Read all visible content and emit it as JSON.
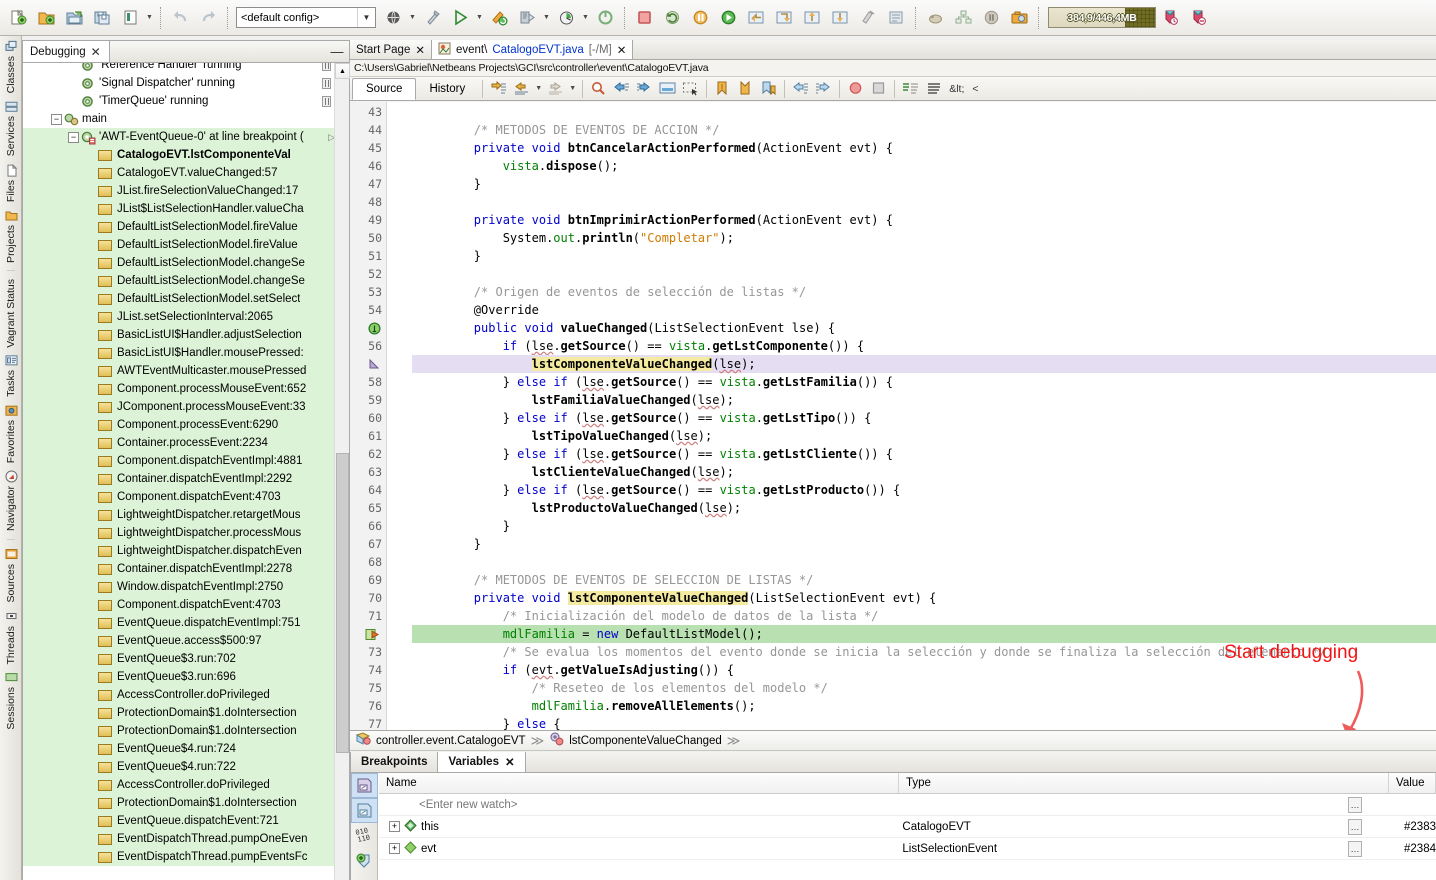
{
  "toolbar": {
    "config_value": "<default config>",
    "memory": "384,9/446,4MB",
    "buttons": [
      {
        "name": "new-file-button",
        "label": "New File"
      },
      {
        "name": "new-project-button",
        "label": "New Project"
      },
      {
        "name": "open-project-button",
        "label": "Open Project"
      },
      {
        "name": "save-all-button",
        "label": "Save All"
      },
      {
        "name": "open-recent-button",
        "label": "Open Recent"
      },
      {
        "name": "undo-button",
        "label": "Undo"
      },
      {
        "name": "redo-button",
        "label": "Redo"
      },
      {
        "name": "build-project-button",
        "label": "Build Project"
      },
      {
        "name": "clean-build-button",
        "label": "Clean and Build"
      },
      {
        "name": "run-project-button",
        "label": "Run Project"
      },
      {
        "name": "debug-project-button",
        "label": "Debug Project"
      },
      {
        "name": "profile-project-button",
        "label": "Profile Project"
      },
      {
        "name": "team-button",
        "label": "Team"
      },
      {
        "name": "stop-button",
        "label": "Finish Debugger Session"
      },
      {
        "name": "continue-button",
        "label": "Continue"
      },
      {
        "name": "pause-button",
        "label": "Pause"
      },
      {
        "name": "step-over-button",
        "label": "Step Over"
      },
      {
        "name": "step-into-button",
        "label": "Step Into"
      },
      {
        "name": "step-out-button",
        "label": "Step Out"
      },
      {
        "name": "run-to-cursor-button",
        "label": "Run to Cursor"
      },
      {
        "name": "apply-code-changes-button",
        "label": "Apply Code Changes"
      },
      {
        "name": "take-gc-button",
        "label": "Garbage Collect"
      },
      {
        "name": "heap-walker-button",
        "label": "Heap Walker"
      },
      {
        "name": "screenshot-button",
        "label": "Take Screenshot"
      },
      {
        "name": "new-watch-button",
        "label": "New Watch"
      },
      {
        "name": "toggle-breakpoint-button",
        "label": "Toggle Breakpoint"
      }
    ]
  },
  "left_rail": {
    "tabs": [
      {
        "label": "Classes",
        "icon": "classes-icon"
      },
      {
        "label": "Services",
        "icon": "services-icon"
      },
      {
        "label": "Files",
        "icon": "files-icon"
      },
      {
        "label": "Projects",
        "icon": "projects-icon"
      },
      {
        "label": "Vagrant Status",
        "icon": "vagrant-icon"
      },
      {
        "label": "Tasks",
        "icon": "tasks-icon"
      },
      {
        "label": "Favorites",
        "icon": "favorites-icon"
      },
      {
        "label": "Navigator",
        "icon": "navigator-icon"
      },
      {
        "label": "Sources",
        "icon": "sources-icon"
      },
      {
        "label": "Threads",
        "icon": "threads-icon"
      },
      {
        "label": "Sessions",
        "icon": "sessions-icon"
      }
    ]
  },
  "debugging_panel": {
    "tab_label": "Debugging",
    "close_label": "✕",
    "minimize_label": "—",
    "rows": [
      {
        "label": "'Reference Handler' running",
        "type": "thread",
        "clipped": true,
        "green": false,
        "depth": 2
      },
      {
        "label": "'Signal Dispatcher' running",
        "type": "thread",
        "green": false,
        "depth": 2
      },
      {
        "label": "'TimerQueue' running",
        "type": "thread",
        "green": false,
        "depth": 2
      },
      {
        "label": "main",
        "type": "group",
        "green": false,
        "depth": 1
      },
      {
        "label": "'AWT-EventQueue-0' at line breakpoint (",
        "type": "current-thread",
        "green": true,
        "depth": 2
      },
      {
        "label": "CatalogoEVT.lstComponenteVal",
        "type": "frame",
        "green": true,
        "bold": true,
        "depth": 3
      },
      {
        "label": "CatalogoEVT.valueChanged:57",
        "type": "frame",
        "green": true,
        "depth": 3
      },
      {
        "label": "JList.fireSelectionValueChanged:17",
        "type": "frame",
        "green": true,
        "depth": 3
      },
      {
        "label": "JList$ListSelectionHandler.valueCha",
        "type": "frame",
        "green": true,
        "depth": 3
      },
      {
        "label": "DefaultListSelectionModel.fireValue",
        "type": "frame",
        "green": true,
        "depth": 3
      },
      {
        "label": "DefaultListSelectionModel.fireValue",
        "type": "frame",
        "green": true,
        "depth": 3
      },
      {
        "label": "DefaultListSelectionModel.changeSe",
        "type": "frame",
        "green": true,
        "depth": 3
      },
      {
        "label": "DefaultListSelectionModel.changeSe",
        "type": "frame",
        "green": true,
        "depth": 3
      },
      {
        "label": "DefaultListSelectionModel.setSelect",
        "type": "frame",
        "green": true,
        "depth": 3
      },
      {
        "label": "JList.setSelectionInterval:2065",
        "type": "frame",
        "green": true,
        "depth": 3
      },
      {
        "label": "BasicListUI$Handler.adjustSelection",
        "type": "frame",
        "green": true,
        "depth": 3
      },
      {
        "label": "BasicListUI$Handler.mousePressed:",
        "type": "frame",
        "green": true,
        "depth": 3
      },
      {
        "label": "AWTEventMulticaster.mousePressed",
        "type": "frame",
        "green": true,
        "depth": 3
      },
      {
        "label": "Component.processMouseEvent:652",
        "type": "frame",
        "green": true,
        "depth": 3
      },
      {
        "label": "JComponent.processMouseEvent:33",
        "type": "frame",
        "green": true,
        "depth": 3
      },
      {
        "label": "Component.processEvent:6290",
        "type": "frame",
        "green": true,
        "depth": 3
      },
      {
        "label": "Container.processEvent:2234",
        "type": "frame",
        "green": true,
        "depth": 3
      },
      {
        "label": "Component.dispatchEventImpl:4881",
        "type": "frame",
        "green": true,
        "depth": 3
      },
      {
        "label": "Container.dispatchEventImpl:2292",
        "type": "frame",
        "green": true,
        "depth": 3
      },
      {
        "label": "Component.dispatchEvent:4703",
        "type": "frame",
        "green": true,
        "depth": 3
      },
      {
        "label": "LightweightDispatcher.retargetMous",
        "type": "frame",
        "green": true,
        "depth": 3
      },
      {
        "label": "LightweightDispatcher.processMous",
        "type": "frame",
        "green": true,
        "depth": 3
      },
      {
        "label": "LightweightDispatcher.dispatchEven",
        "type": "frame",
        "green": true,
        "depth": 3
      },
      {
        "label": "Container.dispatchEventImpl:2278",
        "type": "frame",
        "green": true,
        "depth": 3
      },
      {
        "label": "Window.dispatchEventImpl:2750",
        "type": "frame",
        "green": true,
        "depth": 3
      },
      {
        "label": "Component.dispatchEvent:4703",
        "type": "frame",
        "green": true,
        "depth": 3
      },
      {
        "label": "EventQueue.dispatchEventImpl:751",
        "type": "frame",
        "green": true,
        "depth": 3
      },
      {
        "label": "EventQueue.access$500:97",
        "type": "frame",
        "green": true,
        "depth": 3
      },
      {
        "label": "EventQueue$3.run:702",
        "type": "frame",
        "green": true,
        "depth": 3
      },
      {
        "label": "EventQueue$3.run:696",
        "type": "frame",
        "green": true,
        "depth": 3
      },
      {
        "label": "AccessController.doPrivileged",
        "type": "frame",
        "green": true,
        "depth": 3
      },
      {
        "label": "ProtectionDomain$1.doIntersection",
        "type": "frame",
        "green": true,
        "depth": 3
      },
      {
        "label": "ProtectionDomain$1.doIntersection",
        "type": "frame",
        "green": true,
        "depth": 3
      },
      {
        "label": "EventQueue$4.run:724",
        "type": "frame",
        "green": true,
        "depth": 3
      },
      {
        "label": "EventQueue$4.run:722",
        "type": "frame",
        "green": true,
        "depth": 3
      },
      {
        "label": "AccessController.doPrivileged",
        "type": "frame",
        "green": true,
        "depth": 3
      },
      {
        "label": "ProtectionDomain$1.doIntersection",
        "type": "frame",
        "green": true,
        "depth": 3
      },
      {
        "label": "EventQueue.dispatchEvent:721",
        "type": "frame",
        "green": true,
        "depth": 3
      },
      {
        "label": "EventDispatchThread.pumpOneEven",
        "type": "frame",
        "green": true,
        "depth": 3
      },
      {
        "label": "EventDispatchThread.pumpEventsFc",
        "type": "frame",
        "green": true,
        "depth": 3
      }
    ]
  },
  "editor": {
    "tabs": [
      {
        "label": "Start Page",
        "active": false,
        "name": "tab-start-page"
      },
      {
        "label": "event\\",
        "filename": "CatalogoEVT.java",
        "modifier": "[-/M]",
        "active": true,
        "name": "tab-catalogoevt"
      }
    ],
    "file_path": "C:\\Users\\Gabriel\\Netbeans Projects\\GCI\\src\\controller\\event\\CatalogoEVT.java",
    "view_tabs": [
      {
        "label": "Source",
        "active": true
      },
      {
        "label": "History",
        "active": false
      }
    ],
    "toolbar_text": [
      "&lt;",
      "<"
    ],
    "toolbar_buttons": [
      {
        "name": "last-edit-button",
        "label": "Last Edit"
      },
      {
        "name": "back-button",
        "label": "Back"
      },
      {
        "name": "forward-button",
        "label": "Forward"
      },
      {
        "name": "find-selection-button",
        "label": "Find Selection"
      },
      {
        "name": "find-previous-button",
        "label": "Find Previous"
      },
      {
        "name": "find-next-button",
        "label": "Find Next"
      },
      {
        "name": "toggle-highlight-button",
        "label": "Toggle Highlight Search"
      },
      {
        "name": "toggle-rect-selection-button",
        "label": "Toggle Rectangular Selection"
      },
      {
        "name": "previous-bookmark-button",
        "label": "Previous Bookmark"
      },
      {
        "name": "next-bookmark-button",
        "label": "Next Bookmark"
      },
      {
        "name": "toggle-bookmark-button",
        "label": "Toggle Bookmark"
      },
      {
        "name": "shift-left-button",
        "label": "Shift Line Left"
      },
      {
        "name": "shift-right-button",
        "label": "Shift Line Right"
      },
      {
        "name": "stop-macro-button",
        "label": "Stop Macro Recording"
      },
      {
        "name": "start-macro-button",
        "label": "Start Macro Recording"
      },
      {
        "name": "comment-button",
        "label": "Comment"
      },
      {
        "name": "uncomment-button",
        "label": "Uncomment"
      }
    ],
    "margin_line_column": 120,
    "annotation": {
      "text": "Start debugging",
      "color": "#f21414"
    },
    "exec_line": 72,
    "frame_line": 57,
    "code": [
      {
        "n": 43,
        "t": ""
      },
      {
        "n": 44,
        "t": "        /* METODOS DE EVENTOS DE ACCION */",
        "style": "comment"
      },
      {
        "n": 45,
        "t": "        private void btnCancelarActionPerformed(ActionEvent evt) {",
        "fold": "start"
      },
      {
        "n": 46,
        "t": "            vista.dispose();"
      },
      {
        "n": 47,
        "t": "        }",
        "fold": "end"
      },
      {
        "n": 48,
        "t": ""
      },
      {
        "n": 49,
        "t": "        private void btnImprimirActionPerformed(ActionEvent evt) {",
        "fold": "start"
      },
      {
        "n": 50,
        "t": "            System.out.println(\"Completar\");"
      },
      {
        "n": 51,
        "t": "        }",
        "fold": "end"
      },
      {
        "n": 52,
        "t": ""
      },
      {
        "n": 53,
        "t": "        /* Origen de eventos de selección de listas */",
        "style": "comment"
      },
      {
        "n": 54,
        "t": "        @Override"
      },
      {
        "n": 55,
        "t": "        public void valueChanged(ListSelectionEvent lse) {",
        "gutter": "override",
        "fold": "start"
      },
      {
        "n": 56,
        "t": "            if (lse.getSource() == vista.getLstComponente()) {"
      },
      {
        "n": 57,
        "t": "                lstComponenteValueChanged(lse);",
        "gutter": "frame",
        "highlight": "frame"
      },
      {
        "n": 58,
        "t": "            } else if (lse.getSource() == vista.getLstFamilia()) {"
      },
      {
        "n": 59,
        "t": "                lstFamiliaValueChanged(lse);"
      },
      {
        "n": 60,
        "t": "            } else if (lse.getSource() == vista.getLstTipo()) {"
      },
      {
        "n": 61,
        "t": "                lstTipoValueChanged(lse);"
      },
      {
        "n": 62,
        "t": "            } else if (lse.getSource() == vista.getLstCliente()) {"
      },
      {
        "n": 63,
        "t": "                lstClienteValueChanged(lse);"
      },
      {
        "n": 64,
        "t": "            } else if (lse.getSource() == vista.getLstProducto()) {"
      },
      {
        "n": 65,
        "t": "                lstProductoValueChanged(lse);"
      },
      {
        "n": 66,
        "t": "            }"
      },
      {
        "n": 67,
        "t": "        }",
        "fold": "end"
      },
      {
        "n": 68,
        "t": ""
      },
      {
        "n": 69,
        "t": "        /* METODOS DE EVENTOS DE SELECCION DE LISTAS */",
        "style": "comment"
      },
      {
        "n": 70,
        "t": "        private void lstComponenteValueChanged(ListSelectionEvent evt) {",
        "fold": "start"
      },
      {
        "n": 71,
        "t": "            /* Inicialización del modelo de datos de la lista */",
        "style": "comment"
      },
      {
        "n": 72,
        "t": "            mdlFamilia = new DefaultListModel();",
        "gutter": "exec",
        "highlight": "exec"
      },
      {
        "n": 73,
        "t": "            /* Se evalua los momentos del evento donde se inicia la selección y donde se finaliza la selección del elemento */",
        "style": "comment"
      },
      {
        "n": 74,
        "t": "            if (evt.getValueIsAdjusting()) {"
      },
      {
        "n": 75,
        "t": "                /* Reseteo de los elementos del modelo */",
        "style": "comment"
      },
      {
        "n": 76,
        "t": "                mdlFamilia.removeAllElements();"
      },
      {
        "n": 77,
        "t": "            } else {"
      }
    ]
  },
  "breadcrumb": {
    "items": [
      {
        "label": "controller.event.CatalogoEVT",
        "icon": "class-icon"
      },
      {
        "label": "lstComponenteValueChanged",
        "icon": "method-icon"
      }
    ],
    "separator": "≫"
  },
  "variables_panel": {
    "tabs": [
      {
        "label": "Breakpoints",
        "active": false,
        "name": "tab-breakpoints"
      },
      {
        "label": "Variables",
        "active": true,
        "name": "tab-variables",
        "closable": true
      }
    ],
    "close_label": "✕",
    "columns": [
      "Name",
      "Type",
      "Value"
    ],
    "watch_placeholder": "<Enter new watch>",
    "rows": [
      {
        "name": "this",
        "type": "CatalogoEVT",
        "value": "#2383",
        "icon": "field-icon",
        "expandable": true
      },
      {
        "name": "evt",
        "type": "ListSelectionEvent",
        "value": "#2384",
        "icon": "local-var-icon",
        "expandable": true
      }
    ],
    "side_buttons": [
      {
        "name": "create-variable-button",
        "selected": true
      },
      {
        "name": "create-watch-button",
        "selected": true
      },
      {
        "name": "display-binary-button",
        "selected": false
      },
      {
        "name": "new-watch-button",
        "selected": false
      }
    ]
  }
}
